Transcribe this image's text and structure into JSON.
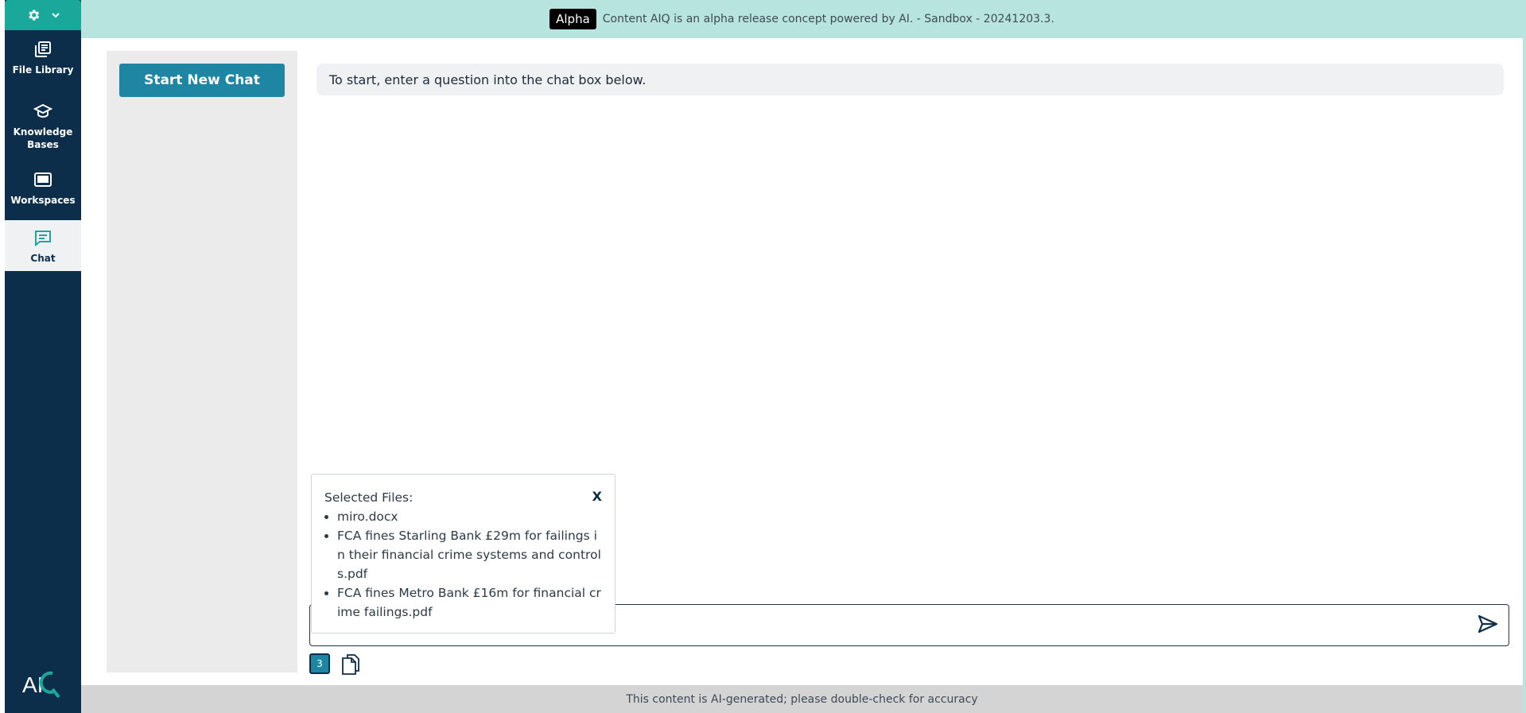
{
  "banner": {
    "badge": "Alpha",
    "text": "Content AIQ is an alpha release concept powered by AI. - Sandbox - 20241203.3."
  },
  "sidebar": {
    "settings_icon": "gear-icon",
    "items": [
      {
        "label": "File Library",
        "icon": "library-icon"
      },
      {
        "label": "Knowledge Bases",
        "icon": "graduation-cap-icon"
      },
      {
        "label": "Workspaces",
        "icon": "workspace-icon"
      },
      {
        "label": "Chat",
        "icon": "chat-icon",
        "active": true
      }
    ],
    "logo_text": "AI"
  },
  "chat_list": {
    "new_chat_label": "Start New Chat"
  },
  "chat": {
    "intro_message": "To start, enter a question into the chat box below.",
    "input_value": "",
    "input_placeholder": ""
  },
  "selected_files": {
    "title": "Selected Files:",
    "close_label": "X",
    "files": [
      "miro.docx",
      "FCA fines Starling Bank £29m for failings in their financial crime systems and controls.pdf",
      "FCA fines Metro Bank £16m for financial crime failings.pdf"
    ],
    "count": "3"
  },
  "footer": {
    "text": "This content is AI-generated; please double-check for accuracy"
  },
  "colors": {
    "sidebar": "#0c2e4b",
    "accent_teal": "#1aa89a",
    "button_blue": "#1e86a3",
    "banner": "#b7e4df"
  }
}
